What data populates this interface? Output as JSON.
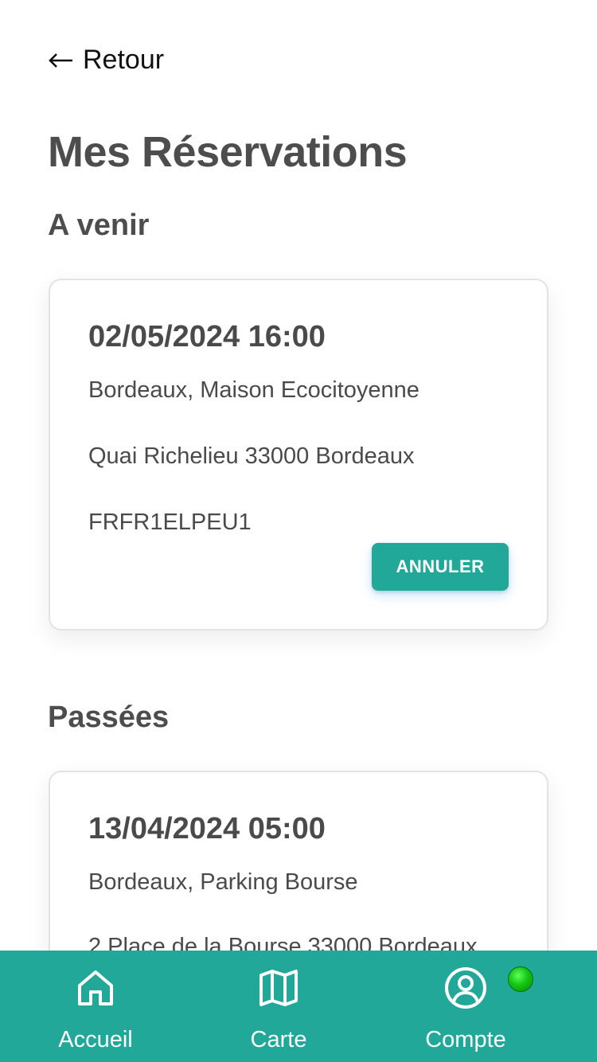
{
  "header": {
    "back_label": "Retour",
    "page_title": "Mes Réservations"
  },
  "upcoming": {
    "section_title": "A venir",
    "reservations": [
      {
        "datetime": "02/05/2024 16:00",
        "station": "Bordeaux, Maison Ecocitoyenne",
        "address": "Quai Richelieu 33000 Bordeaux",
        "code": "FRFR1ELPEU1",
        "cancel_label": "ANNULER"
      }
    ]
  },
  "past": {
    "section_title": "Passées",
    "reservations": [
      {
        "datetime": "13/04/2024 05:00",
        "station": "Bordeaux, Parking Bourse",
        "address": "2 Place de la Bourse 33000 Bordeaux"
      }
    ]
  },
  "bottom_nav": {
    "items": [
      {
        "label": "Accueil",
        "icon": "home-icon"
      },
      {
        "label": "Carte",
        "icon": "map-icon"
      },
      {
        "label": "Compte",
        "icon": "account-circle-icon"
      }
    ],
    "status_color": "#14c614"
  },
  "colors": {
    "accent": "#22a898",
    "text": "#4a4a4a"
  }
}
